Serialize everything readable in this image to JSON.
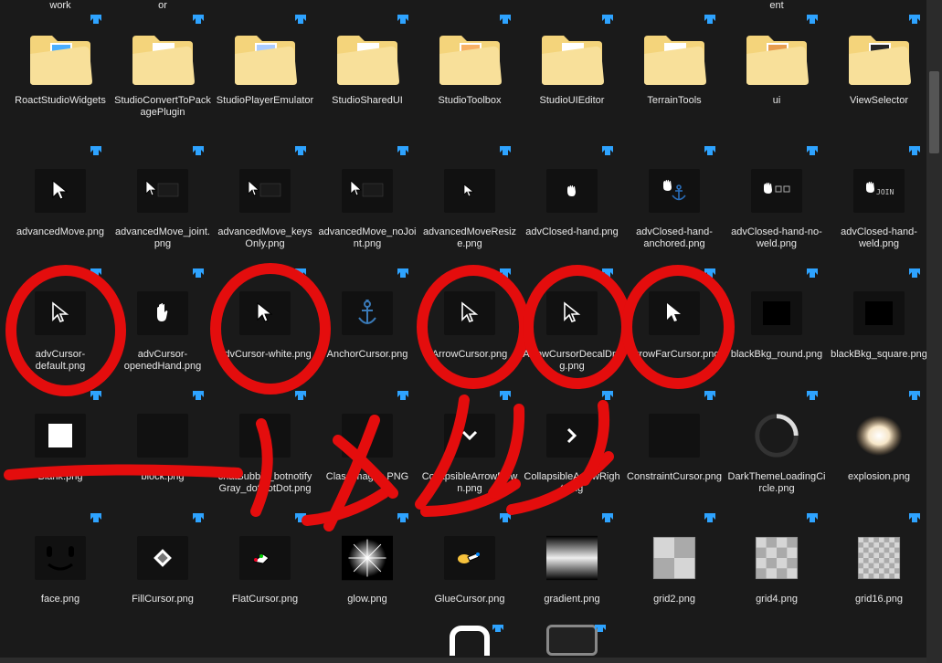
{
  "top_partial_row": [
    "work",
    "or",
    "",
    "",
    "",
    "",
    "",
    "ent",
    ""
  ],
  "rows": [
    [
      {
        "name": "RoactStudioWidgets",
        "type": "folder",
        "accent": "#2aa0ff"
      },
      {
        "name": "StudioConvertToPackagePlugin",
        "type": "folder",
        "accent": null
      },
      {
        "name": "StudioPlayerEmulator",
        "type": "folder",
        "accent": "#9cc3ff"
      },
      {
        "name": "StudioSharedUI",
        "type": "folder",
        "accent": null
      },
      {
        "name": "StudioToolbox",
        "type": "folder",
        "accent": "#f7a24a"
      },
      {
        "name": "StudioUIEditor",
        "type": "folder",
        "accent": null
      },
      {
        "name": "TerrainTools",
        "type": "folder",
        "accent": null
      },
      {
        "name": "ui",
        "type": "folder",
        "accent": "#e48b2f"
      },
      {
        "name": "ViewSelector",
        "type": "folder",
        "accent": "#000"
      }
    ],
    [
      {
        "name": "advancedMove.png",
        "type": "png",
        "icon": "cursor-white"
      },
      {
        "name": "advancedMove_joint.png",
        "type": "png",
        "icon": "cursor-text"
      },
      {
        "name": "advancedMove_keysOnly.png",
        "type": "png",
        "icon": "cursor-text"
      },
      {
        "name": "advancedMove_noJoint.png",
        "type": "png",
        "icon": "cursor-text"
      },
      {
        "name": "advancedMoveResize.png",
        "type": "png",
        "icon": "cursor-tiny"
      },
      {
        "name": "advClosed-hand.png",
        "type": "png",
        "icon": "hand-closed"
      },
      {
        "name": "advClosed-hand-anchored.png",
        "type": "png",
        "icon": "hand-anchor"
      },
      {
        "name": "advClosed-hand-no-weld.png",
        "type": "png",
        "icon": "hand-noweld"
      },
      {
        "name": "advClosed-hand-weld.png",
        "type": "png",
        "icon": "hand-weld"
      }
    ],
    [
      {
        "name": "advCursor-default.png",
        "type": "png",
        "icon": "cursor-outline"
      },
      {
        "name": "advCursor-openedHand.png",
        "type": "png",
        "icon": "hand-open"
      },
      {
        "name": "advCursor-white.png",
        "type": "png",
        "icon": "cursor-white"
      },
      {
        "name": "AnchorCursor.png",
        "type": "png",
        "icon": "anchor"
      },
      {
        "name": "ArrowCursor.png",
        "type": "png",
        "icon": "cursor-outline"
      },
      {
        "name": "ArrowCursorDecalDrag.png",
        "type": "png",
        "icon": "cursor-outline"
      },
      {
        "name": "ArrowFarCursor.png",
        "type": "png",
        "icon": "cursor-solid"
      },
      {
        "name": "blackBkg_round.png",
        "type": "png",
        "icon": "black-sq"
      },
      {
        "name": "blackBkg_square.png",
        "type": "png",
        "icon": "black-sq"
      }
    ],
    [
      {
        "name": "Blank.png",
        "type": "png",
        "icon": "white-sq"
      },
      {
        "name": "block.png",
        "type": "png",
        "icon": "blank"
      },
      {
        "name": "chatBubble_botnotifyGray_dotDotDot.png",
        "type": "png",
        "icon": "blank"
      },
      {
        "name": "ClassImages.PNG",
        "type": "png",
        "icon": "blank"
      },
      {
        "name": "CollapsibleArrowDown.png",
        "type": "png",
        "icon": "chev-down"
      },
      {
        "name": "CollapsibleArrowRight.png",
        "type": "png",
        "icon": "chev-right"
      },
      {
        "name": "ConstraintCursor.png",
        "type": "png",
        "icon": "blank"
      },
      {
        "name": "DarkThemeLoadingCircle.png",
        "type": "png",
        "icon": "loading-ring"
      },
      {
        "name": "explosion.png",
        "type": "png",
        "icon": "explosion"
      }
    ],
    [
      {
        "name": "face.png",
        "type": "png",
        "icon": "face"
      },
      {
        "name": "FillCursor.png",
        "type": "png",
        "icon": "fill"
      },
      {
        "name": "FlatCursor.png",
        "type": "png",
        "icon": "flat"
      },
      {
        "name": "glow.png",
        "type": "png",
        "icon": "glow"
      },
      {
        "name": "GlueCursor.png",
        "type": "png",
        "icon": "glue"
      },
      {
        "name": "gradient.png",
        "type": "png",
        "icon": "gradient"
      },
      {
        "name": "grid2.png",
        "type": "png",
        "icon": "grid2"
      },
      {
        "name": "grid4.png",
        "type": "png",
        "icon": "grid4"
      },
      {
        "name": "grid16.png",
        "type": "png",
        "icon": "grid16"
      }
    ]
  ]
}
